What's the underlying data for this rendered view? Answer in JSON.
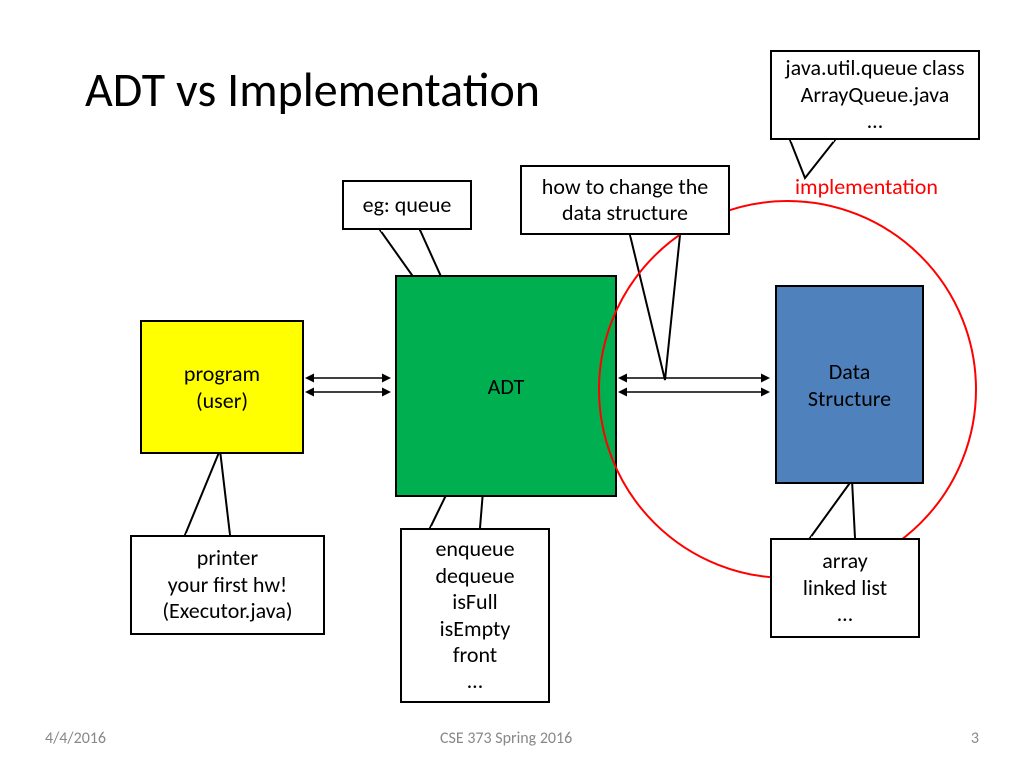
{
  "slide": {
    "title": "ADT vs Implementation",
    "footer_date": "4/4/2016",
    "footer_center": "CSE 373 Spring 2016",
    "footer_page": "3"
  },
  "boxes": {
    "program": {
      "line1": "program",
      "line2": "(user)"
    },
    "adt": {
      "label": "ADT"
    },
    "ds": {
      "line1": "Data",
      "line2": "Structure"
    }
  },
  "callouts": {
    "eg_queue": "eg: queue",
    "how_change": {
      "l1": "how to change the",
      "l2": "data structure"
    },
    "impl_top": {
      "l1": "java.util.queue class",
      "l2": "ArrayQueue.java",
      "l3": "…"
    },
    "printer": {
      "l1": "printer",
      "l2": "your first hw!",
      "l3": "(Executor.java)"
    },
    "ops": {
      "l1": "enqueue",
      "l2": "dequeue",
      "l3": "isFull",
      "l4": "isEmpty",
      "l5": "front",
      "l6": "…"
    },
    "array_ll": {
      "l1": "array",
      "l2": "linked list",
      "l3": "…"
    }
  },
  "labels": {
    "implementation": "implementation"
  }
}
